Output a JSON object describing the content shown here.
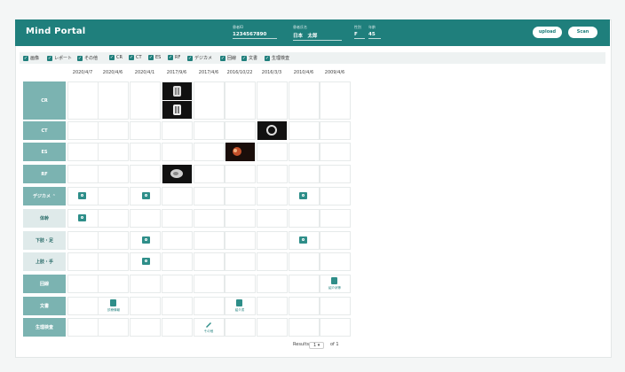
{
  "header": {
    "app_title": "Mind Portal",
    "patient_id_label": "患者ID",
    "patient_id_value": "1234567890",
    "patient_name_label": "患者氏名",
    "patient_name_value": "日本　太郎",
    "sex_label": "性別",
    "sex_value": "F",
    "age_label": "年齢",
    "age_value": "45",
    "upload_label": "upload",
    "scan_label": "Scan"
  },
  "filters": [
    {
      "label": "画像"
    },
    {
      "label": "レポート"
    },
    {
      "label": "その他"
    },
    {
      "label": "CR"
    },
    {
      "label": "CT"
    },
    {
      "label": "ES"
    },
    {
      "label": "RF"
    },
    {
      "label": "デジカメ"
    },
    {
      "label": "回線"
    },
    {
      "label": "文書"
    },
    {
      "label": "生理検査"
    }
  ],
  "columns": [
    "2020/4/7",
    "2020/4/6",
    "2020/4/1",
    "2017/9/6",
    "2017/4/6",
    "2016/10/22",
    "2016/3/3",
    "2010/4/6",
    "2009/4/6"
  ],
  "rows": [
    {
      "label": "CR",
      "color": "#7bb3b1"
    },
    {
      "label": "CT",
      "color": "#7bb3b1"
    },
    {
      "label": "ES",
      "color": "#7bb3b1"
    },
    {
      "label": "RF",
      "color": "#7bb3b1"
    },
    {
      "label": "デジカメ ⌃",
      "color": "#7bb3b1"
    },
    {
      "label": "体幹",
      "color": "#dfeaea"
    },
    {
      "label": "下肢・足",
      "color": "#dfeaea"
    },
    {
      "label": "上肢・手",
      "color": "#dfeaea"
    },
    {
      "label": "回線",
      "color": "#7bb3b1"
    },
    {
      "label": "文書",
      "color": "#7bb3b1"
    },
    {
      "label": "生理検査",
      "color": "#7bb3b1"
    }
  ],
  "cell_labels": {
    "kaisen_2009": "紹介状等",
    "bunsho_2020_4_6": "診療情報",
    "bunsho_2016": "紹介書",
    "seiri_2017": "その他"
  },
  "pager": {
    "results_label": "Results",
    "page_value": "1",
    "of_label": "of 1"
  },
  "colors": {
    "brand": "#1f7f7c",
    "row_header": "#7bb3b1",
    "sub_row_header": "#dfeaea"
  }
}
